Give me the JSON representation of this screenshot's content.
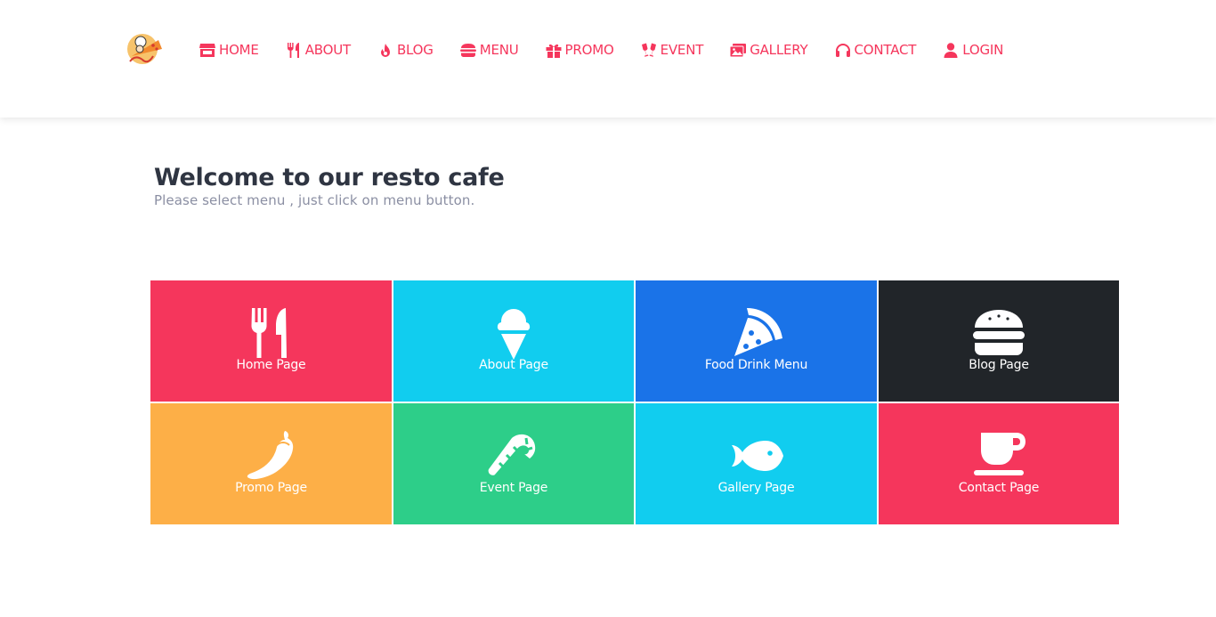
{
  "colors": {
    "accent": "#f5365c",
    "red": "#f5365c",
    "cyan": "#11cdef",
    "blue": "#1a73e8",
    "dark": "#212529",
    "orange": "#fdaf47",
    "green": "#2dce89"
  },
  "navbar": {
    "logo_icon": "chef-logo",
    "items": [
      {
        "label": "HOME",
        "icon": "store-icon"
      },
      {
        "label": "ABOUT",
        "icon": "utensils-icon"
      },
      {
        "label": "BLOG",
        "icon": "fire-icon"
      },
      {
        "label": "MENU",
        "icon": "hamburger-icon"
      },
      {
        "label": "PROMO",
        "icon": "gift-icon"
      },
      {
        "label": "EVENT",
        "icon": "glasses-cheers-icon"
      },
      {
        "label": "GALLERY",
        "icon": "images-icon"
      },
      {
        "label": "CONTACT",
        "icon": "headphones-icon"
      },
      {
        "label": "LOGIN",
        "icon": "user-icon"
      }
    ]
  },
  "welcome": {
    "title": "Welcome to our resto cafe",
    "subtitle": "Please select menu , just click on menu button."
  },
  "tiles": [
    {
      "label": "Home Page",
      "icon": "utensils-icon",
      "color": "#f5365c"
    },
    {
      "label": "About Page",
      "icon": "ice-cream-icon",
      "color": "#11cdef"
    },
    {
      "label": "Food Drink Menu",
      "icon": "pizza-slice-icon",
      "color": "#1a73e8"
    },
    {
      "label": "Blog Page",
      "icon": "hamburger-icon",
      "color": "#212529"
    },
    {
      "label": "Promo Page",
      "icon": "pepper-icon",
      "color": "#fdaf47"
    },
    {
      "label": "Event Page",
      "icon": "candy-cane-icon",
      "color": "#2dce89"
    },
    {
      "label": "Gallery Page",
      "icon": "fish-icon",
      "color": "#11cdef"
    },
    {
      "label": "Contact Page",
      "icon": "coffee-icon",
      "color": "#f5365c"
    }
  ]
}
